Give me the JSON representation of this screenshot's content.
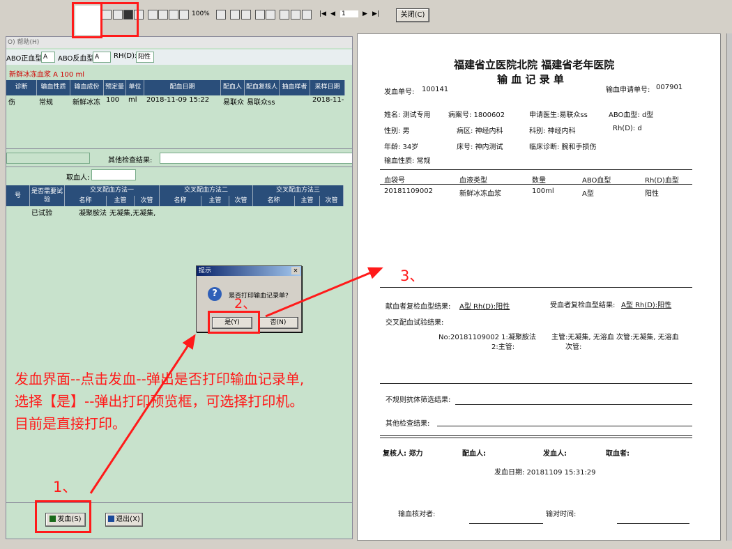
{
  "toolbar": {
    "zoom": "100%",
    "page": "1",
    "close_label": "关闭(C)"
  },
  "left_app": {
    "menu": "O)  帮助(H)",
    "abo_pos_label": "ABO正血型:",
    "abo_pos_value": "A",
    "abo_neg_label": "ABO反血型:",
    "abo_neg_value": "A",
    "rh_label": "RH(D):",
    "rh_value": "阳性",
    "product_line": "新鲜冰冻血浆   A   100   ml",
    "grid_headers": [
      "诊断",
      "输血性质",
      "输血成份",
      "预定量",
      "单位",
      "配血日期",
      "配血人",
      "配血复核人",
      "抽血样者",
      "采样日期"
    ],
    "grid_row": [
      "伤",
      "常规",
      "新鲜冰冻",
      "100",
      "ml",
      "2018-11-09 15:22",
      "易联众",
      "易联众ss",
      "",
      "2018-11-"
    ],
    "other_check_label": "其他检查结果:",
    "fetch_label": "取血人:",
    "cross_headers": {
      "col0": "号",
      "need_test": "是否需要试验",
      "method1": "交叉配血方法一",
      "method2": "交叉配血方法二",
      "method3": "交叉配血方法三",
      "name": "名称",
      "main": "主管",
      "minor": "次管"
    },
    "cross_row": {
      "tested": "已试验",
      "method": "凝聚胺法",
      "result": "无凝集,无凝集,"
    },
    "issue_label": "发血(S)",
    "exit_label": "退出(X)"
  },
  "dialog": {
    "title": "提示",
    "message": "是否打印输血记录单?",
    "yes": "是(Y)",
    "no": "否(N)"
  },
  "report": {
    "hospital": "福建省立医院北院 福建省老年医院",
    "title": "输 血 记 录 单",
    "issue_no_label": "发血单号:",
    "issue_no": "100141",
    "apply_no_label": "输血申请单号:",
    "apply_no": "007901",
    "name": "姓名: 测试专用",
    "case_no": "病案号: 1800602",
    "doctor": "申请医生:易联众ss",
    "abo": "ABO血型: d型",
    "sex": "性别: 男",
    "ward": "病区: 神经内科",
    "dept": "科别: 神经内科",
    "rh": "Rh(D): d",
    "age": "年龄: 34岁",
    "bed": "床号: 神内测试",
    "diagnosis": "临床诊断: 腕和手损伤",
    "nature": "输血性质: 常规",
    "table_headers": [
      "血袋号",
      "血液类型",
      "数量",
      "ABO血型",
      "Rh(D)血型"
    ],
    "table_row": [
      "20181109002",
      "新鲜冰冻血浆",
      "100ml",
      "A型",
      "阳性"
    ],
    "donor_recheck_label": "献血者复检血型结果:",
    "donor_recheck": "A型    Rh(D):阳性",
    "recipient_recheck_label": "受血者复检血型结果:",
    "recipient_recheck": "A型    Rh(D):阳性",
    "cross_label": "交叉配血试验结果:",
    "cross_line1": "No:20181109002 1:凝聚胺法",
    "cross_line2": "2:主管:",
    "cross_main": "主管:无凝集, 无溶血 次管:无凝集, 无溶血",
    "cross_minor": "次管:",
    "antibody_label": "不规则抗体筛选结果:",
    "other_label": "其他检查结果:",
    "reviewer": "复核人: 郑力",
    "matcher": "配血人:",
    "issuer": "发血人:",
    "fetcher": "取血者:",
    "issue_date": "发血日期: 20181109 15:31:29",
    "checker": "输血核对者:",
    "check_time": "输对时间:"
  },
  "annotations": {
    "step1": "1、",
    "step2": "2、",
    "step3": "3、",
    "note_line1": "发血界面--点击发血--弹出是否打印输血记录单,",
    "note_line2": "选择【是】--弹出打印预览框，可选择打印机。",
    "note_line3": "目前是直接打印。"
  },
  "colors": {
    "annotation_red": "#ff1a1a",
    "grid_header": "#2a4e7a",
    "app_bg": "#c8e2cc"
  }
}
